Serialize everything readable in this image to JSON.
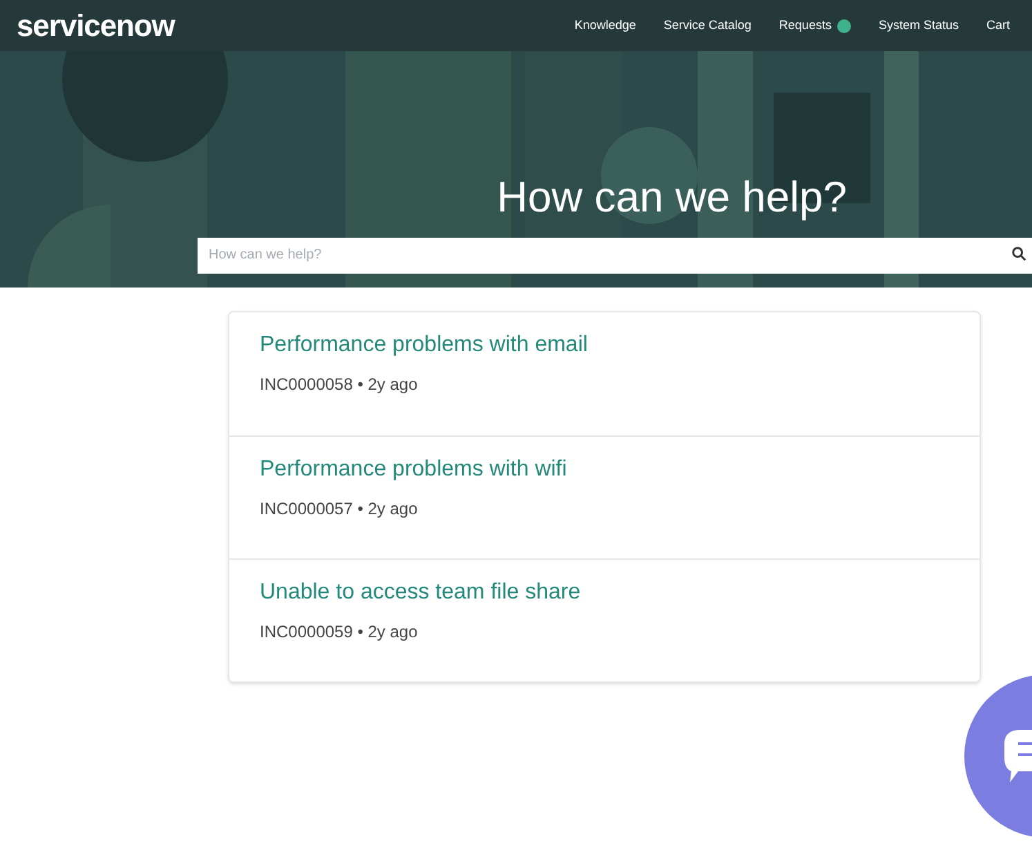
{
  "header": {
    "logo": "servicenow",
    "nav": [
      {
        "label": "Knowledge",
        "badge": false
      },
      {
        "label": "Service Catalog",
        "badge": false
      },
      {
        "label": "Requests",
        "badge": true
      },
      {
        "label": "System Status",
        "badge": false
      },
      {
        "label": "Cart",
        "badge": false
      }
    ]
  },
  "hero": {
    "title": "How can we help?",
    "search": {
      "placeholder": "How can we help?"
    }
  },
  "results": [
    {
      "title": "Performance problems with email",
      "meta": "INC0000058 • 2y ago"
    },
    {
      "title": "Performance problems with wifi",
      "meta": "INC0000057 • 2y ago"
    },
    {
      "title": "Unable to access team file share",
      "meta": "INC0000059 • 2y ago"
    }
  ]
}
